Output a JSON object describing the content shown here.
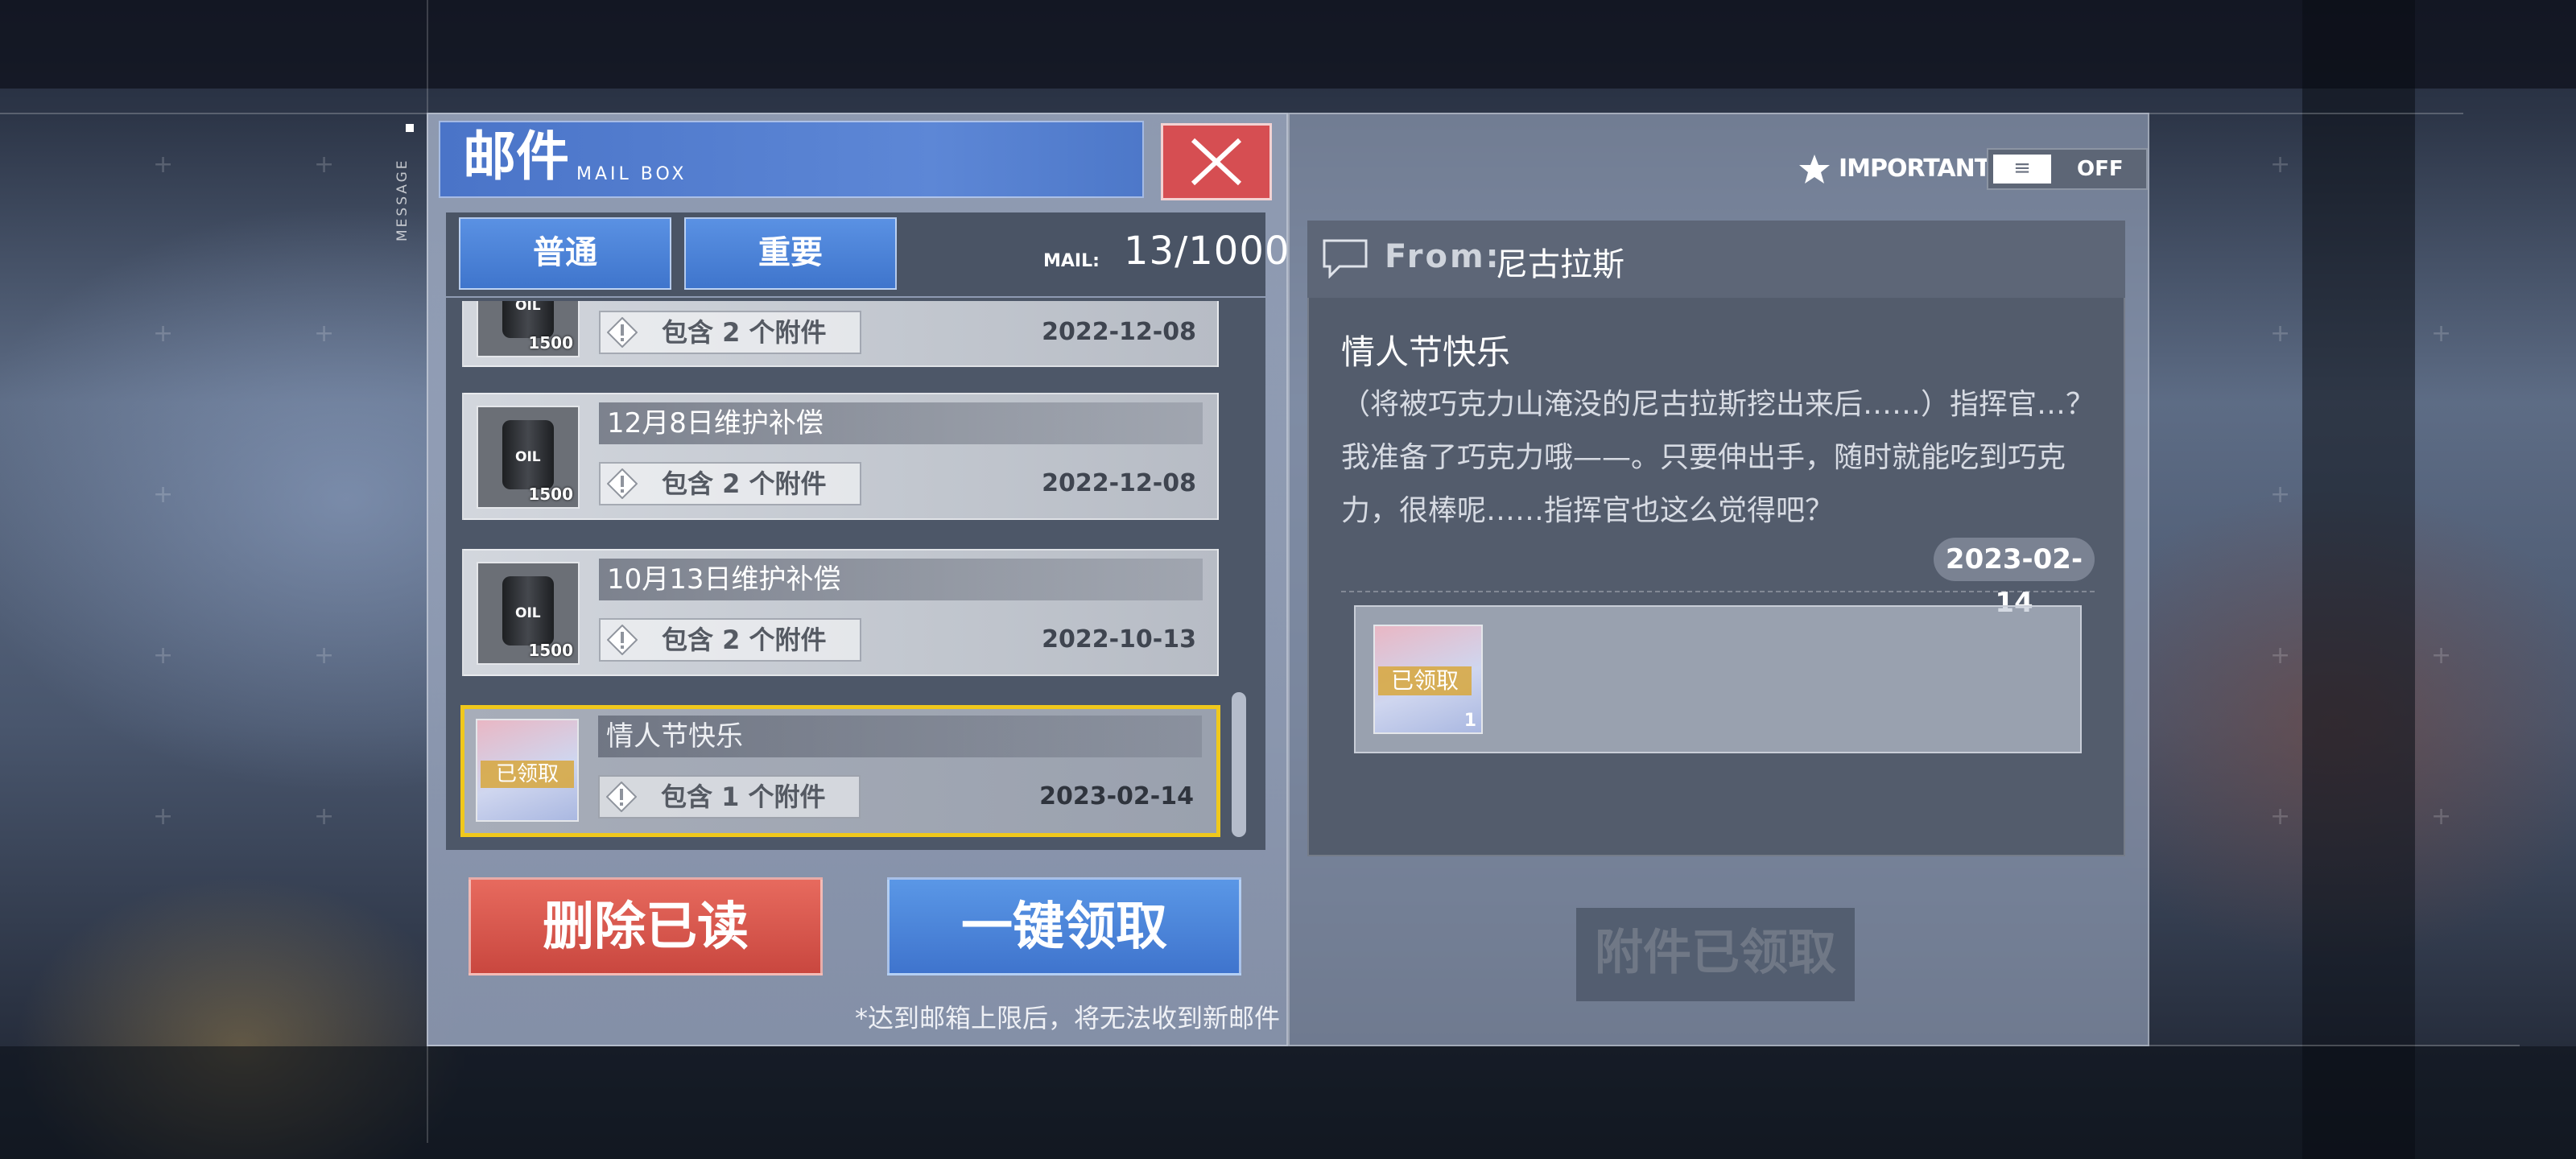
{
  "header": {
    "title_cn": "邮件",
    "title_en": "MAIL BOX",
    "side_label": "MESSAGE"
  },
  "tabs": [
    {
      "label": "普通"
    },
    {
      "label": "重要"
    }
  ],
  "mailbox": {
    "count_label": "MAIL:",
    "count": "13/1000"
  },
  "mails": [
    {
      "title": "",
      "attachment": "包含 2 个附件",
      "date": "2022-12-08",
      "item_qty": "1500",
      "item_label": "OIL",
      "claimed": false
    },
    {
      "title": "12月8日维护补偿",
      "attachment": "包含 2 个附件",
      "date": "2022-12-08",
      "item_qty": "1500",
      "item_label": "OIL",
      "claimed": false
    },
    {
      "title": "10月13日维护补偿",
      "attachment": "包含 2 个附件",
      "date": "2022-10-13",
      "item_qty": "1500",
      "item_label": "OIL",
      "claimed": false
    },
    {
      "title": "情人节快乐",
      "attachment": "包含 1 个附件",
      "date": "2023-02-14",
      "item_qty": "1",
      "claimed_label": "已领取",
      "claimed": true,
      "selected": true
    }
  ],
  "actions": {
    "delete_read": "删除已读",
    "claim_all": "一键领取",
    "footnote": "*达到邮箱上限后，将无法收到新邮件",
    "attachment_claimed": "附件已领取"
  },
  "important_filter": {
    "label": "IMPORTANT",
    "state": "OFF",
    "knob_symbol": "≡"
  },
  "detail": {
    "from_label": "From:",
    "from_name": "尼古拉斯",
    "title": "情人节快乐",
    "body": "（将被巧克力山淹没的尼古拉斯挖出来后……）指挥官…？我准备了巧克力哦——。只要伸出手，随时就能吃到巧克力，很棒呢……指挥官也这么觉得吧？",
    "date": "2023-02-14",
    "attachment": {
      "claimed_label": "已领取",
      "qty": "1"
    }
  },
  "colors": {
    "accent_blue": "#4a7fd6",
    "accent_red": "#d64e52",
    "selected_border": "#f0c81c"
  }
}
